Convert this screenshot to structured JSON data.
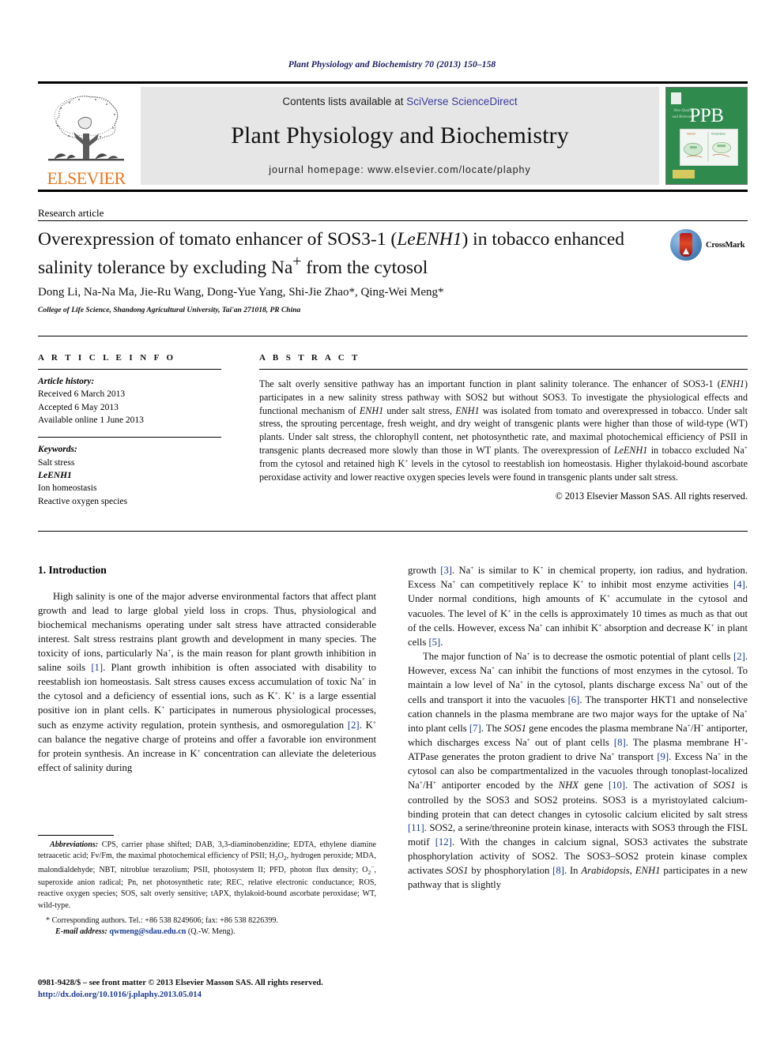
{
  "running_head": "Plant Physiology and Biochemistry 70 (2013) 150–158",
  "masthead": {
    "elsevier_wordmark": "ELSEVIER",
    "contents_prefix": "Contents lists available at ",
    "contents_link": "SciVerse ScienceDirect",
    "journal_name": "Plant Physiology and Biochemistry",
    "homepage": "journal homepage: www.elsevier.com/locate/plaphy",
    "cover_acronym": "PPB",
    "cover_caption": "New Quality and Relevance"
  },
  "article": {
    "type_label": "Research article",
    "title_line1_a": "Overexpression of tomato enhancer of SOS3-1 (",
    "title_line1_ital": "LeENH1",
    "title_line1_b": ") in tobacco",
    "title_line2": "enhanced salinity tolerance by excluding Na",
    "title_line2_sup": "+",
    "title_line2_end": " from the cytosol",
    "authors": "Dong Li, Na-Na Ma, Jie-Ru Wang, Dong-Yue Yang, Shi-Jie Zhao*, Qing-Wei Meng*",
    "affiliation": "College of Life Science, Shandong Agricultural University, Tai'an 271018, PR China",
    "crossmark_label": "CrossMark"
  },
  "article_info": {
    "heading": "A R T I C L E  I N F O",
    "history_label": "Article history:",
    "history": [
      "Received 6 March 2013",
      "Accepted 6 May 2013",
      "Available online 1 June 2013"
    ],
    "keywords_label": "Keywords:",
    "keywords": [
      "Salt stress",
      "LeENH1",
      "Ion homeostasis",
      "Reactive oxygen species"
    ]
  },
  "abstract": {
    "heading": "A B S T R A C T",
    "p1": "The salt overly sensitive pathway has an important function in plant salinity tolerance. The enhancer of SOS3-1 (ENH1) participates in a new salinity stress pathway with SOS2 but without SOS3. To investigate the physiological effects and functional mechanism of ENH1 under salt stress, ENH1 was isolated from tomato and overexpressed in tobacco. Under salt stress, the sprouting percentage, fresh weight, and dry weight of transgenic plants were higher than those of wild-type (WT) plants. Under salt stress, the chlorophyll content, net photosynthetic rate, and maximal photochemical efficiency of PSII in transgenic plants decreased more slowly than those in WT plants. The overexpression of LeENH1 in tobacco excluded Na+ from the cytosol and retained high K+ levels in the cytosol to reestablish ion homeostasis. Higher thylakoid-bound ascorbate peroxidase activity and lower reactive oxygen species levels were found in transgenic plants under salt stress.",
    "copyright": "© 2013 Elsevier Masson SAS. All rights reserved."
  },
  "body": {
    "section_number_title": "1. Introduction",
    "left_p1": "High salinity is one of the major adverse environmental factors that affect plant growth and lead to large global yield loss in crops. Thus, physiological and biochemical mechanisms operating under salt stress have attracted considerable interest. Salt stress restrains plant growth and development in many species. The toxicity of ions, particularly Na+, is the main reason for plant growth inhibition in saline soils [1]. Plant growth inhibition is often associated with disability to reestablish ion homeostasis. Salt stress causes excess accumulation of toxic Na+ in the cytosol and a deficiency of essential ions, such as K+. K+ is a large essential positive ion in plant cells. K+ participates in numerous physiological processes, such as enzyme activity regulation, protein synthesis, and osmoregulation [2]. K+ can balance the negative charge of proteins and offer a favorable ion environment for protein synthesis. An increase in K+ concentration can alleviate the deleterious effect of salinity during",
    "right_p1": "growth [3]. Na+ is similar to K+ in chemical property, ion radius, and hydration. Excess Na+ can competitively replace K+ to inhibit most enzyme activities [4]. Under normal conditions, high amounts of K+ accumulate in the cytosol and vacuoles. The level of K+ in the cells is approximately 10 times as much as that out of the cells. However, excess Na+ can inhibit K+ absorption and decrease K+ in plant cells [5].",
    "right_p2": "The major function of Na+ is to decrease the osmotic potential of plant cells [2]. However, excess Na+ can inhibit the functions of most enzymes in the cytosol. To maintain a low level of Na+ in the cytosol, plants discharge excess Na+ out of the cells and transport it into the vacuoles [6]. The transporter HKT1 and nonselective cation channels in the plasma membrane are two major ways for the uptake of Na+ into plant cells [7]. The SOS1 gene encodes the plasma membrane Na+/H+ antiporter, which discharges excess Na+ out of plant cells [8]. The plasma membrane H+-ATPase generates the proton gradient to drive Na+ transport [9]. Excess Na+ in the cytosol can also be compartmentalized in the vacuoles through tonoplast-localized Na+/H+ antiporter encoded by the NHX gene [10]. The activation of SOS1 is controlled by the SOS3 and SOS2 proteins. SOS3 is a myristoylated calcium-binding protein that can detect changes in cytosolic calcium elicited by salt stress [11]. SOS2, a serine/threonine protein kinase, interacts with SOS3 through the FISL motif [12]. With the changes in calcium signal, SOS3 activates the substrate phosphorylation activity of SOS2. The SOS3–SOS2 protein kinase complex activates SOS1 by phosphorylation [8]. In Arabidopsis, ENH1 participates in a new pathway that is slightly"
  },
  "footnotes": {
    "abbrev_label": "Abbreviations:",
    "abbrev_text": "CPS, carrier phase shifted; DAB, 3,3-diaminobenzidine; EDTA, ethylene diamine tetraacetic acid; Fv/Fm, the maximal photochemical efficiency of PSII; H2O2, hydrogen peroxide; MDA, malondialdehyde; NBT, nitroblue terazolium; PSII, photosystem II; PFD, photon flux density; O2−, superoxide anion radical; Pn, net photosynthetic rate; REC, relative electronic conductance; ROS, reactive oxygen species; SOS, salt overly sensitive; tAPX, thylakoid-bound ascorbate peroxidase; WT, wild-type.",
    "corresponding": "* Corresponding authors. Tel.: +86 538 8249606; fax: +86 538 8226399.",
    "email_label": "E-mail address:",
    "email": "qwmeng@sdau.edu.cn",
    "email_suffix": " (Q.-W. Meng)."
  },
  "page_footer": {
    "issn_line": "0981-9428/$ – see front matter © 2013 Elsevier Masson SAS. All rights reserved.",
    "doi_line": "http://dx.doi.org/10.1016/j.plaphy.2013.05.014"
  },
  "colors": {
    "link_blue": "#1a3a8f",
    "elsevier_orange": "#E87722",
    "cover_green": "#2f8a4e",
    "running_head_navy": "#1a1a5e"
  }
}
